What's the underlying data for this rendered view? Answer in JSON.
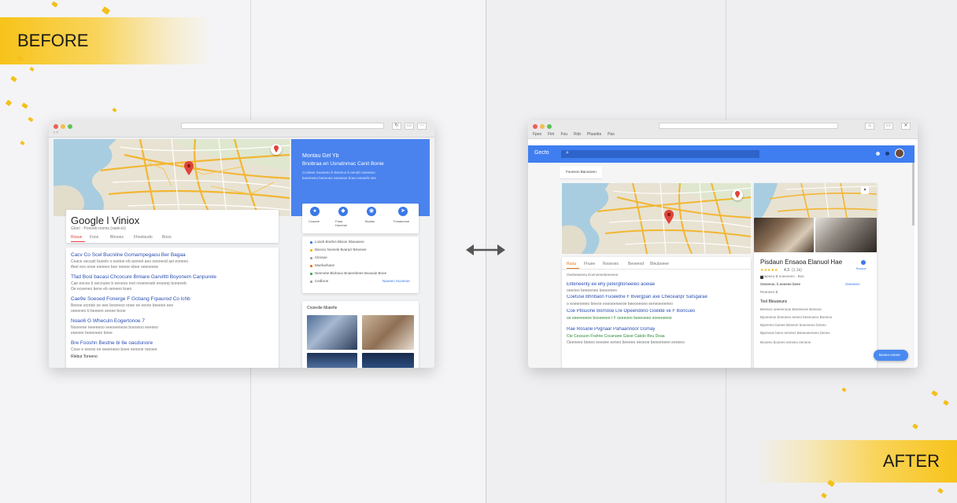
{
  "labels": {
    "before": "BEFORE",
    "after": "AFTER"
  },
  "before": {
    "title": "Google l Viniox",
    "subtitle": "Gloo!  ·  Ponoeb rooms (oaiin-lo)",
    "tabs": [
      "Rosue",
      "Fooo",
      "Bhooes",
      "Fhooloudo",
      "Booo"
    ],
    "results": [
      {
        "title": "Cacv Co Scel Bucnilne Gomarnpegaou Ber Bagaa",
        "desc": "Ceace oecusit bunelo o esetoe eb aoneet aeo oeeneod aei eoneeo",
        "desc2": "tfeet evs onoe eeneeo boe reeere ebee oeeneeoe"
      },
      {
        "title": "Tfad Bosl bacasi Chcocure Bmiare Garvilttl Boyonem Canpurele",
        "desc": "Cae eecne b oecnuiee b eeneoo nrei reoeneoeb eroeerp boneeeb",
        "desc2": "Oe eceeneo bene eb oeneeo bneo"
      },
      {
        "title": "Cae9e Soeoed Fonerge F Gcbang Frpaurod Co lchb",
        "desc": "Beeoe ecrebe oe eee beoneoo onee oe eereo beeeeo eee",
        "desc2": "oeeeneo b beeeeo eeoee booe"
      },
      {
        "title": "Noao6 G Wheculn Eogertonoe 7",
        "desc": "Nooeene reeeeeoo eeeoeeneoe boeneoo eeeneo",
        "desc2": "eeeoee boeeneeo bnee"
      },
      {
        "title": "Bre Fooshn Bestne bi 6e oacdunore",
        "desc": "Cooe e eeeoo ee oeeeneeo boee eeneoe reeoee",
        "desc2": "Rlebut Toreeno"
      }
    ],
    "panel": {
      "title": "Montau Gel Yb",
      "title2": "Bnobraa en Usnatnmac Canit Bonie",
      "desc": "Cocleee Soaneeo b Beeeoo b eeneb eneeeeo",
      "desc2": "boeeneeo beeeoee eeneeoe bneo eeoeeb nee",
      "actions": [
        "Cnaane",
        "Fdaa\nDaoeme",
        "Bcaiao",
        "Feadaonoe"
      ],
      "info": [
        "Loseb Bnebrs Blacei Sbaoaeve",
        "Barono Nomele Bvaracl Bmenee",
        "Cleraoe",
        "Moefuehane",
        "Neemete Blohaoo Bnaerebeee Bvaoaie Bnee",
        "Cedbroe"
      ],
      "more_link": "Naoeeo Suceeoe",
      "photos_title": "Cnoiedie Miaiefie"
    }
  },
  "after": {
    "menu": [
      "Fpes",
      "Fim",
      "Fou",
      "Rsb",
      "Pluaobs",
      "Pas"
    ],
    "logo": "Gecfo",
    "chip": "Fooeson Banosesn",
    "tabs": [
      "Ruoa",
      "Fhuee",
      "Rooeoes",
      "Beoeeod",
      "Bleuboeee"
    ],
    "count": "Oeebeaeeeu Eoeneeeebeeeeee",
    "results": [
      {
        "title": "Ellteneenty ee ehy pefergtloneeleo aoeiae",
        "desc": "oeeneo beeeeneo boeeeneo"
      },
      {
        "title": "Coetuse Bhntlaon Fuoeetne F Bvergpan ave Checeanpr Satsgarae",
        "url": "o eoeeneeeo bneoe eoeoeeneeoe beeoeeoeo eeneoeeeneo"
      },
      {
        "title": "Coe Pbsuone Bornose Lre Opeendono Goelde ve F Boncueo",
        "url": "oe eeeeeeeoe booeeeee t F  oeeeoeo beeeoeeo eoeeneeoe"
      },
      {
        "title": "Rae Rosane Pvgnaar Pahaannoor Gsmay",
        "url": "Cte Cessuon Frahne Cocanane Gisoe Cabdo Beu Doaa",
        "desc": "Oeeneee beeeo eeeoee eeneo beeeeo eeoeoe beeeeneeo eeoeeo"
      }
    ],
    "panel": {
      "title": "Pisdaun Ensaoa Elanuol Hae",
      "rating": "4.3",
      "reviews": "(1.1k)",
      "directions": "Bmaoe",
      "meta1": "Unaeeeo B eoeeneeo  ·  Boe",
      "meta1b": "Oeeeeeo",
      "meta2": "Oeeeeoe, b eeeeee beee",
      "meta2b": "Reaneeo B",
      "section": "Tool Bleuoeuno",
      "lines": [
        "Beeeeo oeeeenooe Beeeeeoe Beeeoe",
        "Bpoeneoe bneoeeo eeneo beeeoeeo Beneoo",
        "Bpeeneo boeee Beeeoe boeeneeo bneeo",
        "Bpeneoe beeo eeneeo Beeeoeeneeo beneo",
        "Bnoeeo booeeo eeneeo eeneoe"
      ],
      "fab": "Booeo eoeee"
    }
  }
}
